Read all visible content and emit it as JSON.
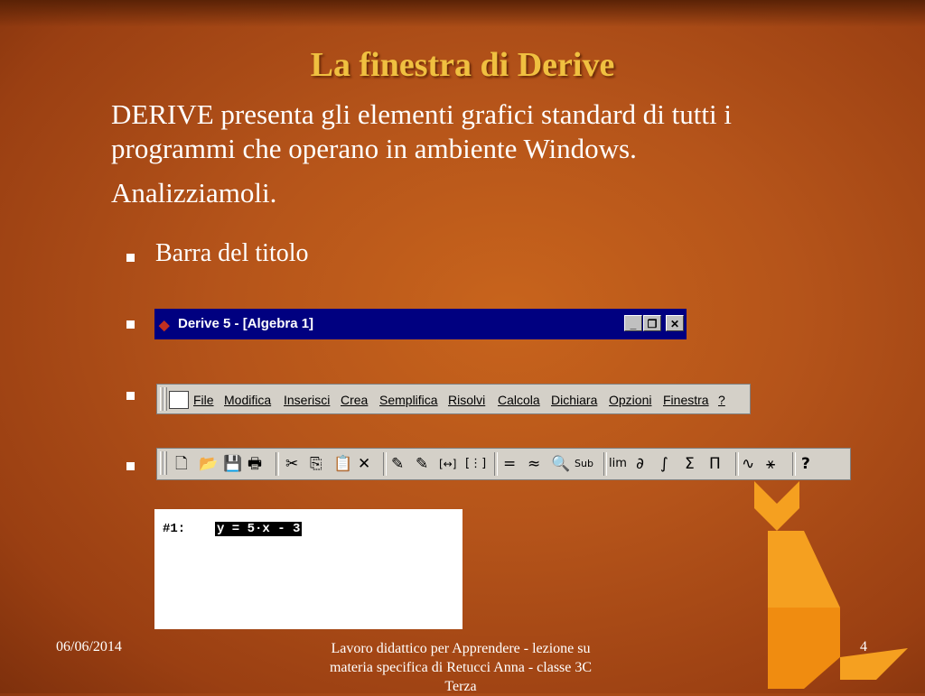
{
  "slide": {
    "title": "La finestra di Derive",
    "intro": "DERIVE presenta gli elementi grafici standard di tutti i programmi che operano in ambiente Windows.",
    "intro2": "Analizziamoli.",
    "bullet1": "Barra del titolo"
  },
  "titlebar": {
    "title": "Derive 5 - [Algebra 1]",
    "minimize": "_",
    "restore": "❐",
    "close": "✕"
  },
  "menubar": {
    "items": [
      "File",
      "Modifica",
      "Inserisci",
      "Crea",
      "Semplifica",
      "Risolvi",
      "Calcola",
      "Dichiara",
      "Opzioni",
      "Finestra",
      "?"
    ]
  },
  "toolbar": {
    "icons": [
      "new-document-icon",
      "open-folder-icon",
      "save-icon",
      "print-icon",
      "cut-icon",
      "copy-icon",
      "paste-icon",
      "delete-icon",
      "author-expression-icon",
      "author-vector-icon",
      "author-matrix-icon",
      "matrix-icon",
      "equals-icon",
      "approximate-icon",
      "zoom-icon",
      "substitute-icon",
      "limit-icon",
      "derivative-icon",
      "integral-icon",
      "sum-icon",
      "product-icon",
      "plot-2d-icon",
      "plot-3d-icon",
      "help-icon"
    ],
    "glyphs": {
      "new": "🗋",
      "open": "📂",
      "save": "💾",
      "print": "🖶",
      "cut": "✂",
      "copy": "⎘",
      "paste": "📋",
      "delete": "✕",
      "author_expr": "✎",
      "author_vec": "✎",
      "vector": "[↔]",
      "matrix": "[⋮]",
      "equals": "=",
      "approx": "≈",
      "zoom": "🔍",
      "sub": "Sub",
      "lim": "lim",
      "deriv": "∂",
      "integral": "∫",
      "sum": "Σ",
      "prod": "Π",
      "plot2d": "∿",
      "plot3d": "⚹",
      "help": "?"
    }
  },
  "algebra": {
    "label": "#1:",
    "expression": "y = 5·x - 3"
  },
  "footer": {
    "date": "06/06/2014",
    "center": "Lavoro didattico per Apprendere - lezione  su materia specifica di Retucci Anna - classe 3C Terza",
    "page": "4"
  },
  "colors": {
    "title": "#f0c040",
    "titlebar": "#000080",
    "tangram": "#f5a020"
  }
}
